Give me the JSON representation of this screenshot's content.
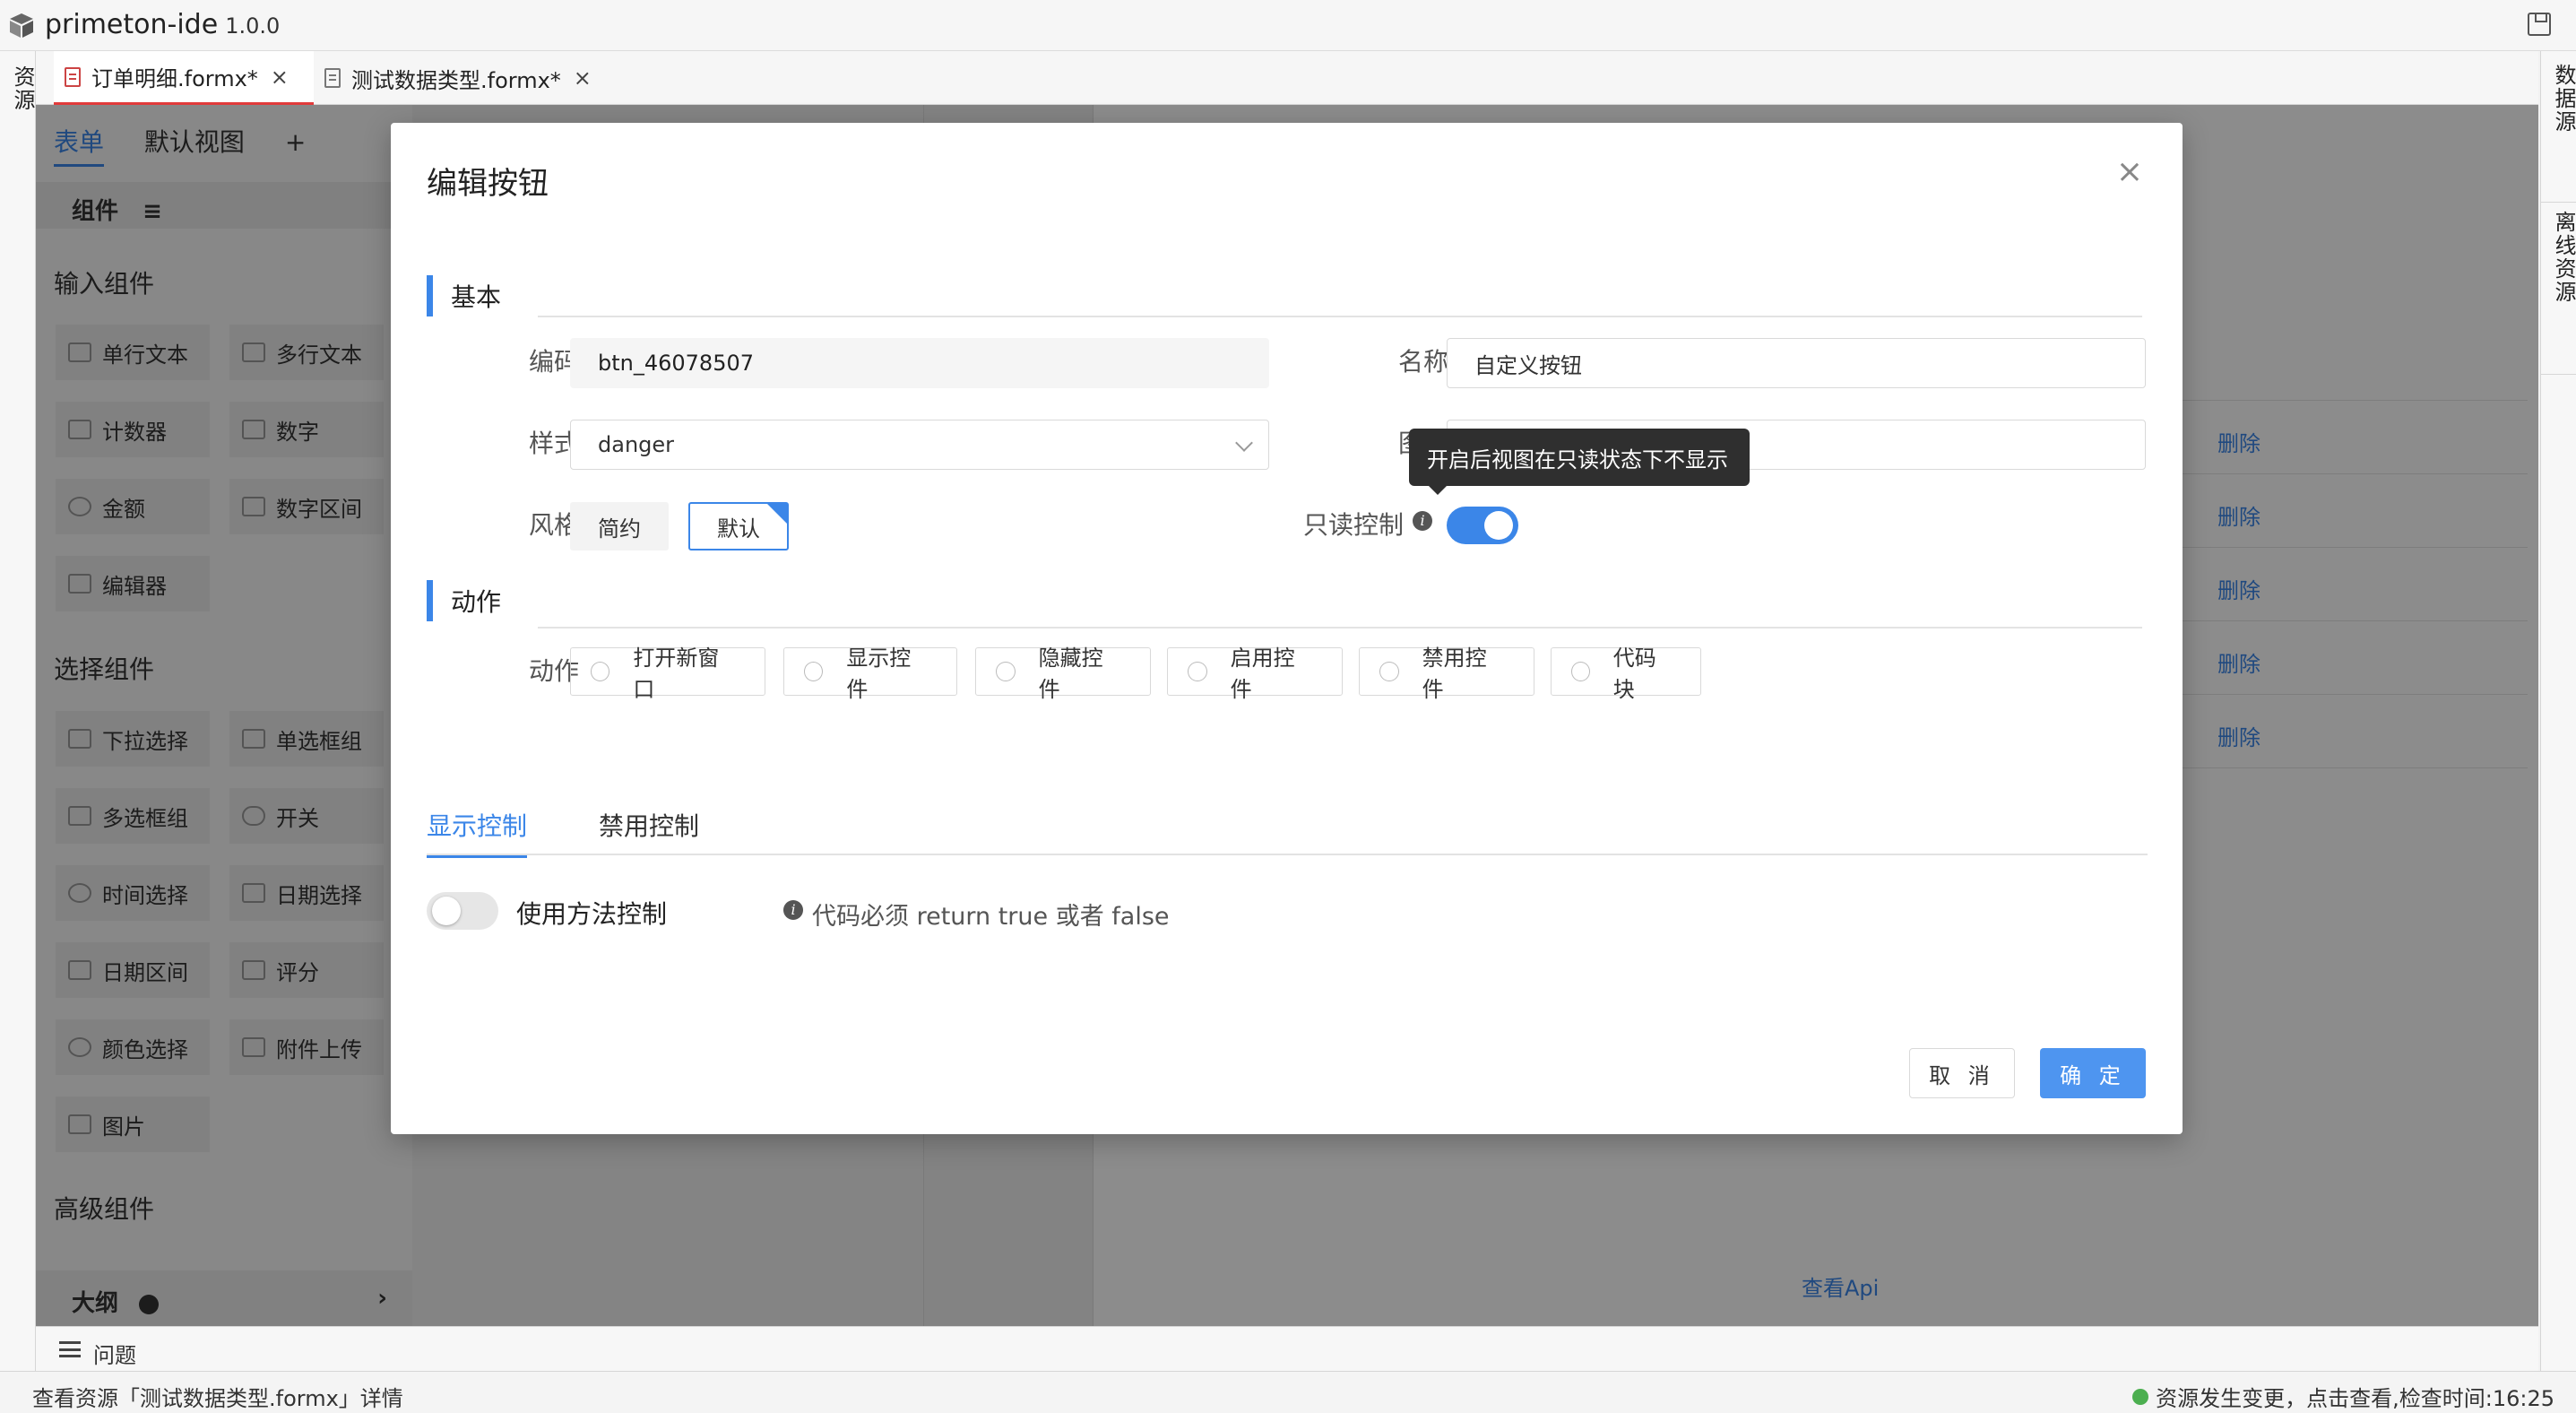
{
  "app": {
    "name": "primeton-ide",
    "version": "1.0.0"
  },
  "left_rail": {
    "label": "资源"
  },
  "right_rail": {
    "items": [
      "数据源",
      "离线资源"
    ]
  },
  "editor_tabs": [
    {
      "label": "订单明细.formx*",
      "active": true
    },
    {
      "label": "测试数据类型.formx*",
      "active": false
    }
  ],
  "left_panel": {
    "tabs": [
      "表单",
      "默认视图"
    ],
    "add": "+",
    "sub_header": "组件",
    "sub_header_icon": "≡",
    "categories": [
      {
        "title": "输入组件",
        "items": [
          "单行文本",
          "多行文本",
          "计数器",
          "数字",
          "金额",
          "数字区间",
          "编辑器"
        ]
      },
      {
        "title": "选择组件",
        "items": [
          "下拉选择",
          "单选框组",
          "多选框组",
          "开关",
          "时间选择",
          "日期选择",
          "日期区间",
          "评分",
          "颜色选择",
          "附件上传",
          "图片"
        ]
      },
      {
        "title": "高级组件",
        "items": []
      }
    ],
    "outline": "大纲"
  },
  "right_panel": {
    "delete_label": "删除",
    "api_link": "查看Api"
  },
  "problems": {
    "label": "问题"
  },
  "status": {
    "left": "查看资源「测试数据类型.formx」详情",
    "right": "资源发生变更，点击查看,检查时间:16:25"
  },
  "modal": {
    "title": "编辑按钮",
    "sections": {
      "basic": "基本",
      "action": "动作"
    },
    "fields": {
      "code_label": "编码",
      "code_value": "btn_46078507",
      "name_label": "名称",
      "name_value": "自定义按钮",
      "style_label": "样式",
      "style_value": "danger",
      "icon_label": "图标",
      "theme_label": "风格",
      "theme_options": [
        "简约",
        "默认"
      ],
      "theme_selected": "默认",
      "readonly_label": "只读控制",
      "readonly_on": true,
      "tooltip": "开启后视图在只读状态下不显示",
      "action_label": "动作",
      "actions": [
        "打开新窗口",
        "显示控件",
        "隐藏控件",
        "启用控件",
        "禁用控件",
        "代码块"
      ]
    },
    "control_tabs": [
      "显示控制",
      "禁用控制"
    ],
    "method_toggle_label": "使用方法控制",
    "method_toggle_on": false,
    "hint": "代码必须 return true 或者 false",
    "buttons": {
      "cancel": "取 消",
      "ok": "确 定"
    },
    "colors": {
      "accent": "#3b86e8"
    }
  }
}
